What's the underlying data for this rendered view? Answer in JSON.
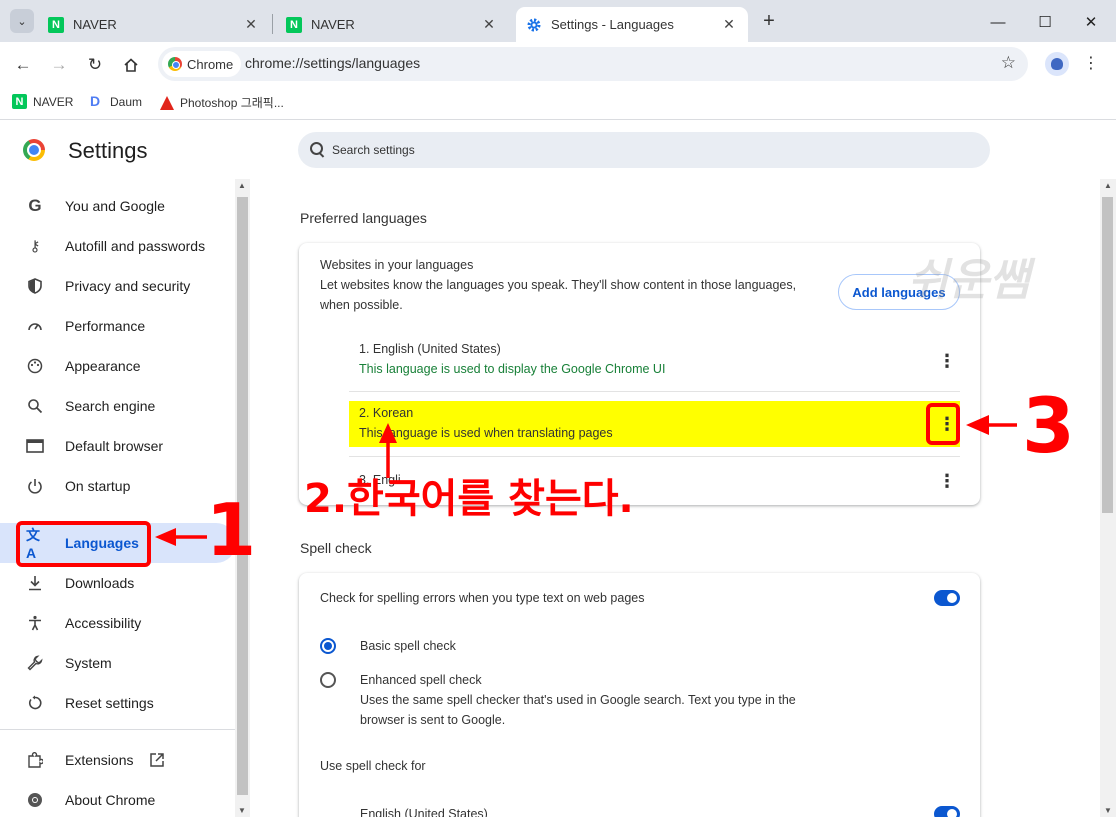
{
  "browser": {
    "tabs": [
      {
        "title": "NAVER",
        "active": false
      },
      {
        "title": "NAVER",
        "active": false
      },
      {
        "title": "Settings - Languages",
        "active": true
      }
    ],
    "new_tab": "+",
    "window_controls": {
      "minimize": "—",
      "maximize": "☐",
      "close": "✕"
    },
    "omnibox": {
      "chip": "Chrome",
      "url": "chrome://settings/languages"
    },
    "bookmarks": [
      {
        "label": "NAVER",
        "icon": "naver-icon"
      },
      {
        "label": "Daum",
        "icon": "daum-icon"
      },
      {
        "label": "Photoshop 그래픽...",
        "icon": "adobe-icon"
      }
    ]
  },
  "settings": {
    "title": "Settings",
    "search_placeholder": "Search settings",
    "nav": [
      {
        "label": "You and Google",
        "icon": "google-icon"
      },
      {
        "label": "Autofill and passwords",
        "icon": "key-icon"
      },
      {
        "label": "Privacy and security",
        "icon": "shield-icon"
      },
      {
        "label": "Performance",
        "icon": "speedometer-icon"
      },
      {
        "label": "Appearance",
        "icon": "palette-icon"
      },
      {
        "label": "Search engine",
        "icon": "search-icon"
      },
      {
        "label": "Default browser",
        "icon": "browser-window-icon"
      },
      {
        "label": "On startup",
        "icon": "power-icon"
      },
      {
        "label": "Languages",
        "icon": "translate-icon",
        "active": true
      },
      {
        "label": "Downloads",
        "icon": "download-icon"
      },
      {
        "label": "Accessibility",
        "icon": "accessibility-icon"
      },
      {
        "label": "System",
        "icon": "wrench-icon"
      },
      {
        "label": "Reset settings",
        "icon": "reset-icon"
      },
      {
        "label": "Extensions",
        "icon": "puzzle-icon"
      },
      {
        "label": "About Chrome",
        "icon": "chrome-icon"
      }
    ]
  },
  "preferred": {
    "section_title": "Preferred languages",
    "card_title": "Websites in your languages",
    "card_desc_1": "Let websites know the languages you speak. They'll show content in those languages,",
    "card_desc_2": "when possible.",
    "add_button": "Add languages",
    "languages": [
      {
        "name": "1. English (United States)",
        "note": "This language is used to display the Google Chrome UI",
        "note_color": "#188038"
      },
      {
        "name": "2. Korean",
        "note": "This language is used when translating pages",
        "highlight": "#ffff00"
      },
      {
        "name": "3. Engli...",
        "note": ""
      }
    ]
  },
  "spell": {
    "section_title": "Spell check",
    "check_label": "Check for spelling errors when you type text on web pages",
    "check_on": true,
    "basic_label": "Basic spell check",
    "enhanced_label": "Enhanced spell check",
    "enhanced_desc_1": "Uses the same spell checker that's used in Google search. Text you type in the",
    "enhanced_desc_2": "browser is sent to Google.",
    "use_for_label": "Use spell check for",
    "use_for_item": "English (United States)"
  },
  "annotations": {
    "num_1": "1",
    "num_3": "3",
    "step_2": "2.한국어를 찾는다.",
    "watermark": "쉬운쌤",
    "color": "#ff0000"
  }
}
